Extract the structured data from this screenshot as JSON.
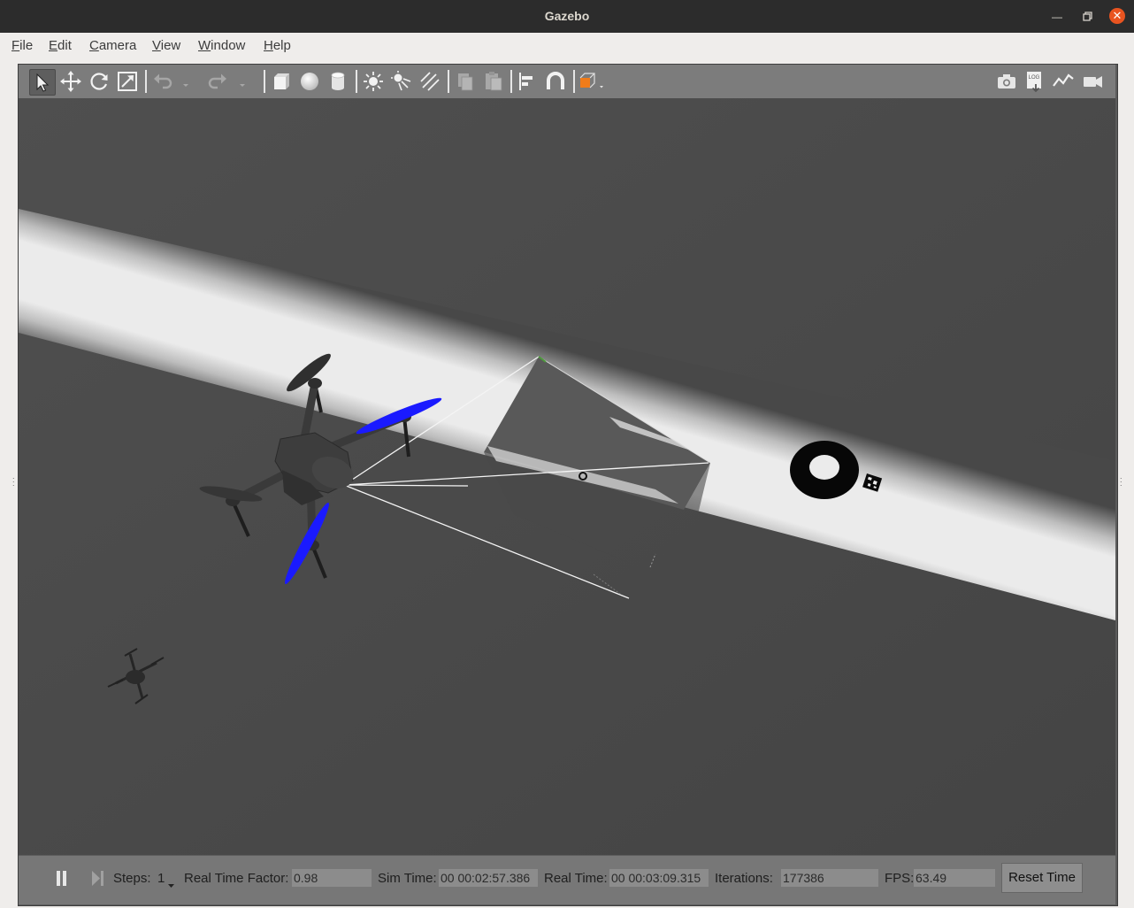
{
  "window": {
    "title": "Gazebo"
  },
  "menu": [
    {
      "label": "File"
    },
    {
      "label": "Edit"
    },
    {
      "label": "Camera"
    },
    {
      "label": "View"
    },
    {
      "label": "Window"
    },
    {
      "label": "Help"
    }
  ],
  "toolbar": {
    "left_icons": [
      "select-arrow-icon",
      "translate-icon",
      "rotate-icon",
      "scale-icon",
      "undo-icon",
      "undo-dropdown-icon",
      "redo-icon",
      "redo-dropdown-icon",
      "box-shape-icon",
      "sphere-shape-icon",
      "cylinder-shape-icon",
      "point-light-icon",
      "spot-light-icon",
      "directional-light-icon",
      "copy-icon",
      "paste-icon",
      "align-icon",
      "snap-magnet-icon",
      "view-angle-icon"
    ],
    "right_icons": [
      "screenshot-camera-icon",
      "log-record-icon",
      "plot-icon",
      "video-record-icon"
    ],
    "log_text": "LOG"
  },
  "status": {
    "steps_label": "Steps:",
    "steps_value": "1",
    "rtf_label": "Real Time Factor:",
    "rtf_value": "0.98",
    "sim_label": "Sim Time:",
    "sim_value": "00 00:02:57.386",
    "real_label": "Real Time:",
    "real_value": "00 00:03:09.315",
    "iter_label": "Iterations:",
    "iter_value": "177386",
    "fps_label": "FPS:",
    "fps_value": "63.49",
    "reset_label": "Reset Time"
  },
  "colors": {
    "titlebar": "#2c2c2c",
    "close_button": "#e95420",
    "toolbar": "#7c7c7c",
    "viewport_ground": "#484848",
    "propeller_blue": "#1a1aff",
    "light_band": "#e8e8e8",
    "active_tool_orange": "#f07c1a"
  }
}
